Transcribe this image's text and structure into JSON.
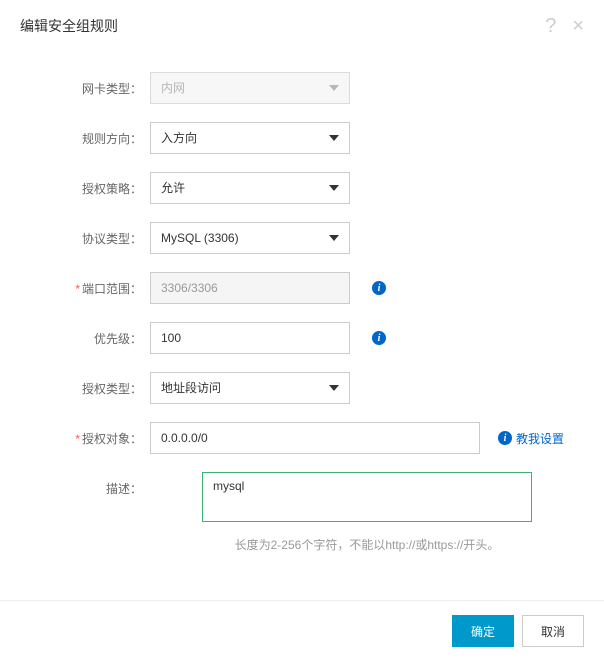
{
  "modal": {
    "title": "编辑安全组规则"
  },
  "form": {
    "nic_type": {
      "label": "网卡类型：",
      "value": "内网"
    },
    "direction": {
      "label": "规则方向：",
      "value": "入方向"
    },
    "auth_policy": {
      "label": "授权策略：",
      "value": "允许"
    },
    "protocol": {
      "label": "协议类型：",
      "value": "MySQL (3306)"
    },
    "port_range": {
      "label": "端口范围：",
      "value": "3306/3306"
    },
    "priority": {
      "label": "优先级：",
      "value": "100"
    },
    "auth_type": {
      "label": "授权类型：",
      "value": "地址段访问"
    },
    "auth_object": {
      "label": "授权对象：",
      "value": "0.0.0.0/0",
      "help_link": "教我设置"
    },
    "description": {
      "label": "描述：",
      "value": "mysql",
      "hint": "长度为2-256个字符，不能以http://或https://开头。"
    }
  },
  "footer": {
    "ok": "确定",
    "cancel": "取消"
  }
}
